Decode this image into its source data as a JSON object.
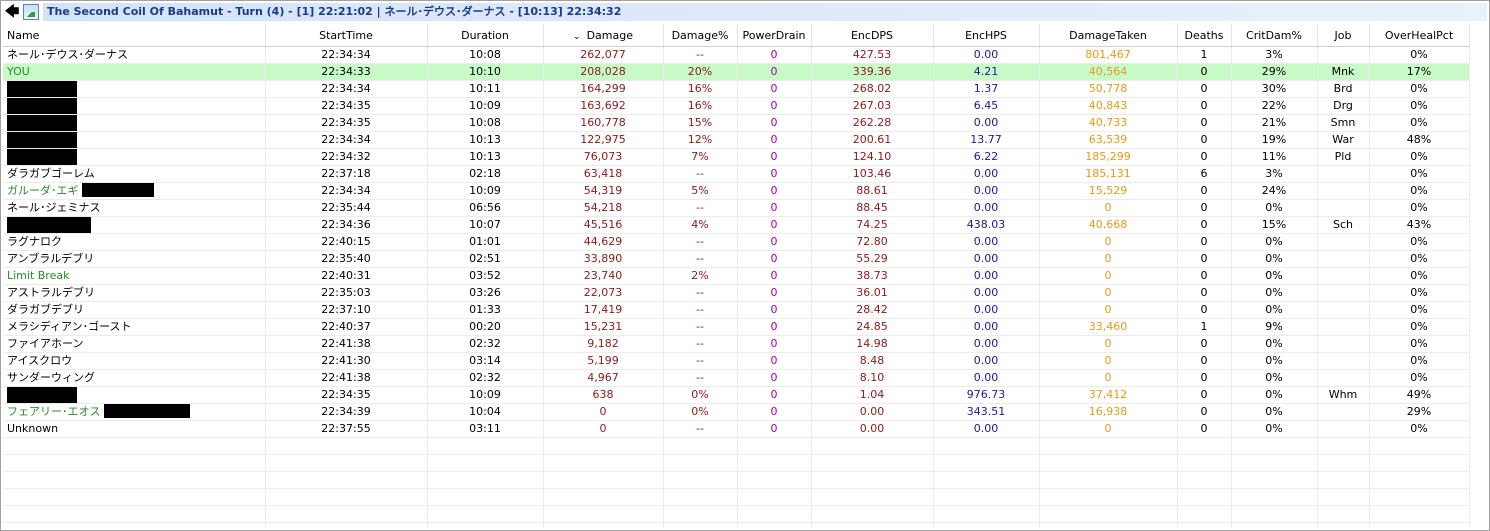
{
  "title": "The Second Coil Of Bahamut - Turn (4) - [1] 22:21:02 | ネール･デウス･ダーナス - [10:13] 22:34:32",
  "icons": {
    "back": "back-arrow-icon",
    "image": "image-icon"
  },
  "colors": {
    "title_bg": "#d4e3f7",
    "title_text": "#1a3a8a",
    "highlight_row": "#c8fac8",
    "damage": "#8b1a1a",
    "power_drain": "#aa00aa",
    "enc_hps": "#1a1a9a",
    "damage_taken": "#e69a1a",
    "pet_name": "#2a8a2a"
  },
  "sort_indicator": "⌄",
  "columns": [
    "Name",
    "StartTime",
    "Duration",
    "Damage",
    "Damage%",
    "PowerDrain",
    "EncDPS",
    "EncHPS",
    "DamageTaken",
    "Deaths",
    "CritDam%",
    "Job",
    "OverHealPct"
  ],
  "rows": [
    {
      "name": "ネール･デウス･ダーナス",
      "start": "22:34:34",
      "dur": "10:08",
      "dmg": "262,077",
      "dpct": "--",
      "pd": "0",
      "dps": "427.53",
      "hps": "0.00",
      "taken": "801,467",
      "deaths": "1",
      "crit": "3%",
      "job": "",
      "oh": "0%"
    },
    {
      "name": "YOU",
      "start": "22:34:33",
      "dur": "10:10",
      "dmg": "208,028",
      "dpct": "20%",
      "pd": "0",
      "dps": "339.36",
      "hps": "4.21",
      "taken": "40,564",
      "deaths": "0",
      "crit": "29%",
      "job": "Mnk",
      "oh": "17%",
      "highlight": true,
      "pet": true
    },
    {
      "name": "",
      "start": "22:34:34",
      "dur": "10:11",
      "dmg": "164,299",
      "dpct": "16%",
      "pd": "0",
      "dps": "268.02",
      "hps": "1.37",
      "taken": "50,778",
      "deaths": "0",
      "crit": "30%",
      "job": "Brd",
      "oh": "0%",
      "redact": 70
    },
    {
      "name": "",
      "start": "22:34:35",
      "dur": "10:09",
      "dmg": "163,692",
      "dpct": "16%",
      "pd": "0",
      "dps": "267.03",
      "hps": "6.45",
      "taken": "40,843",
      "deaths": "0",
      "crit": "22%",
      "job": "Drg",
      "oh": "0%",
      "redact": 70
    },
    {
      "name": "",
      "start": "22:34:35",
      "dur": "10:08",
      "dmg": "160,778",
      "dpct": "15%",
      "pd": "0",
      "dps": "262.28",
      "hps": "0.00",
      "taken": "40,733",
      "deaths": "0",
      "crit": "21%",
      "job": "Smn",
      "oh": "0%",
      "redact": 70
    },
    {
      "name": "",
      "start": "22:34:34",
      "dur": "10:13",
      "dmg": "122,975",
      "dpct": "12%",
      "pd": "0",
      "dps": "200.61",
      "hps": "13.77",
      "taken": "63,539",
      "deaths": "0",
      "crit": "19%",
      "job": "War",
      "oh": "48%",
      "redact": 70
    },
    {
      "name": "",
      "start": "22:34:32",
      "dur": "10:13",
      "dmg": "76,073",
      "dpct": "7%",
      "pd": "0",
      "dps": "124.10",
      "hps": "6.22",
      "taken": "185,299",
      "deaths": "0",
      "crit": "11%",
      "job": "Pld",
      "oh": "0%",
      "redact": 70
    },
    {
      "name": "ダラガブゴーレム",
      "start": "22:37:18",
      "dur": "02:18",
      "dmg": "63,418",
      "dpct": "--",
      "pd": "0",
      "dps": "103.46",
      "hps": "0.00",
      "taken": "185,131",
      "deaths": "6",
      "crit": "3%",
      "job": "",
      "oh": "0%"
    },
    {
      "name": "ガルーダ･エギ",
      "start": "22:34:34",
      "dur": "10:09",
      "dmg": "54,319",
      "dpct": "5%",
      "pd": "0",
      "dps": "88.61",
      "hps": "0.00",
      "taken": "15,529",
      "deaths": "0",
      "crit": "24%",
      "job": "",
      "oh": "0%",
      "pet": true,
      "redact_after": 72
    },
    {
      "name": "ネール･ジェミナス",
      "start": "22:35:44",
      "dur": "06:56",
      "dmg": "54,218",
      "dpct": "--",
      "pd": "0",
      "dps": "88.45",
      "hps": "0.00",
      "taken": "0",
      "deaths": "0",
      "crit": "0%",
      "job": "",
      "oh": "0%"
    },
    {
      "name": "",
      "start": "22:34:36",
      "dur": "10:07",
      "dmg": "45,516",
      "dpct": "4%",
      "pd": "0",
      "dps": "74.25",
      "hps": "438.03",
      "taken": "40,668",
      "deaths": "0",
      "crit": "15%",
      "job": "Sch",
      "oh": "43%",
      "redact": 84
    },
    {
      "name": "ラグナロク",
      "start": "22:40:15",
      "dur": "01:01",
      "dmg": "44,629",
      "dpct": "--",
      "pd": "0",
      "dps": "72.80",
      "hps": "0.00",
      "taken": "0",
      "deaths": "0",
      "crit": "0%",
      "job": "",
      "oh": "0%"
    },
    {
      "name": "アンブラルデブリ",
      "start": "22:35:40",
      "dur": "02:51",
      "dmg": "33,890",
      "dpct": "--",
      "pd": "0",
      "dps": "55.29",
      "hps": "0.00",
      "taken": "0",
      "deaths": "0",
      "crit": "0%",
      "job": "",
      "oh": "0%"
    },
    {
      "name": "Limit Break",
      "start": "22:40:31",
      "dur": "03:52",
      "dmg": "23,740",
      "dpct": "2%",
      "pd": "0",
      "dps": "38.73",
      "hps": "0.00",
      "taken": "0",
      "deaths": "0",
      "crit": "0%",
      "job": "",
      "oh": "0%",
      "pet": true
    },
    {
      "name": "アストラルデブリ",
      "start": "22:35:03",
      "dur": "03:26",
      "dmg": "22,073",
      "dpct": "--",
      "pd": "0",
      "dps": "36.01",
      "hps": "0.00",
      "taken": "0",
      "deaths": "0",
      "crit": "0%",
      "job": "",
      "oh": "0%"
    },
    {
      "name": "ダラガブデブリ",
      "start": "22:37:10",
      "dur": "01:33",
      "dmg": "17,419",
      "dpct": "--",
      "pd": "0",
      "dps": "28.42",
      "hps": "0.00",
      "taken": "0",
      "deaths": "0",
      "crit": "0%",
      "job": "",
      "oh": "0%"
    },
    {
      "name": "メラシディアン･ゴースト",
      "start": "22:40:37",
      "dur": "00:20",
      "dmg": "15,231",
      "dpct": "--",
      "pd": "0",
      "dps": "24.85",
      "hps": "0.00",
      "taken": "33,460",
      "deaths": "1",
      "crit": "9%",
      "job": "",
      "oh": "0%"
    },
    {
      "name": "ファイアホーン",
      "start": "22:41:38",
      "dur": "02:32",
      "dmg": "9,182",
      "dpct": "--",
      "pd": "0",
      "dps": "14.98",
      "hps": "0.00",
      "taken": "0",
      "deaths": "0",
      "crit": "0%",
      "job": "",
      "oh": "0%"
    },
    {
      "name": "アイスクロウ",
      "start": "22:41:30",
      "dur": "03:14",
      "dmg": "5,199",
      "dpct": "--",
      "pd": "0",
      "dps": "8.48",
      "hps": "0.00",
      "taken": "0",
      "deaths": "0",
      "crit": "0%",
      "job": "",
      "oh": "0%"
    },
    {
      "name": "サンダーウィング",
      "start": "22:41:38",
      "dur": "02:32",
      "dmg": "4,967",
      "dpct": "--",
      "pd": "0",
      "dps": "8.10",
      "hps": "0.00",
      "taken": "0",
      "deaths": "0",
      "crit": "0%",
      "job": "",
      "oh": "0%"
    },
    {
      "name": "",
      "start": "22:34:35",
      "dur": "10:09",
      "dmg": "638",
      "dpct": "0%",
      "pd": "0",
      "dps": "1.04",
      "hps": "976.73",
      "taken": "37,412",
      "deaths": "0",
      "crit": "0%",
      "job": "Whm",
      "oh": "49%",
      "redact": 70
    },
    {
      "name": "フェアリー･エオス",
      "start": "22:34:39",
      "dur": "10:04",
      "dmg": "0",
      "dpct": "0%",
      "pd": "0",
      "dps": "0.00",
      "hps": "343.51",
      "taken": "16,938",
      "deaths": "0",
      "crit": "0%",
      "job": "",
      "oh": "29%",
      "pet": true,
      "redact_after": 86
    },
    {
      "name": "Unknown",
      "start": "22:37:55",
      "dur": "03:11",
      "dmg": "0",
      "dpct": "--",
      "pd": "0",
      "dps": "0.00",
      "hps": "0.00",
      "taken": "0",
      "deaths": "0",
      "crit": "0%",
      "job": "",
      "oh": "0%"
    }
  ]
}
